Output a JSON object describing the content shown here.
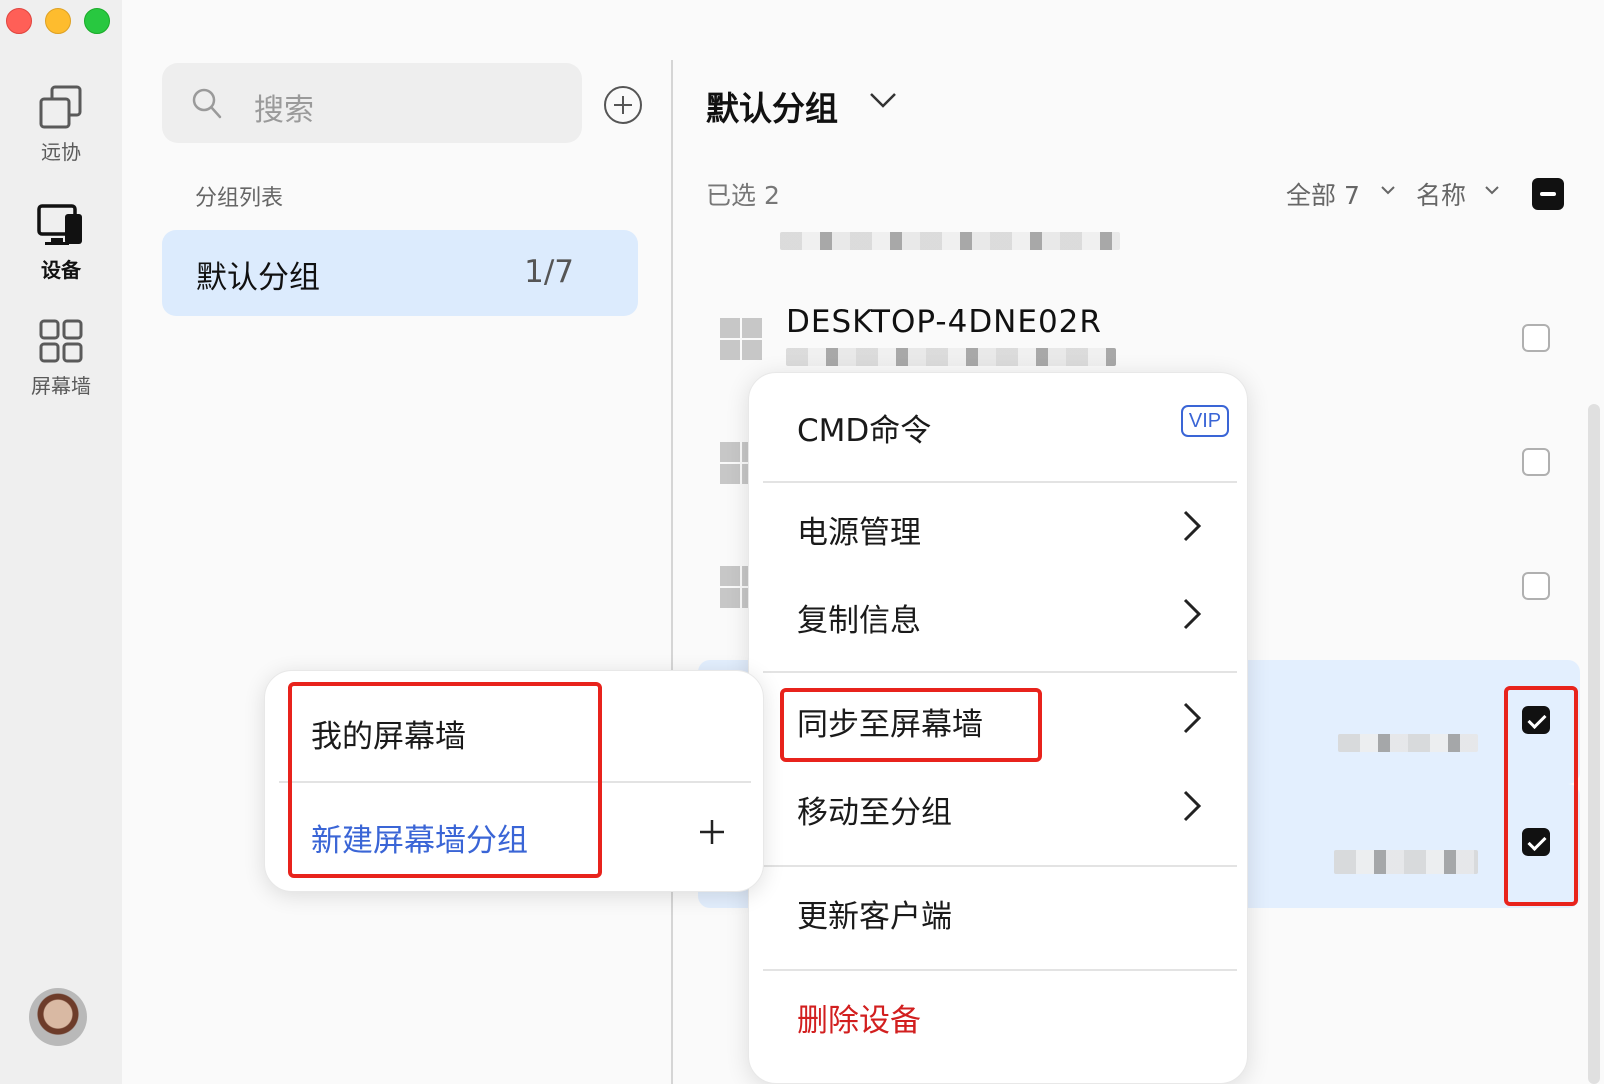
{
  "window": {
    "controls": {
      "close_color": "#ff5f57",
      "minimize_color": "#febc2e",
      "zoom_color": "#28c840"
    }
  },
  "rail": {
    "items": [
      {
        "label": "远协",
        "icon": "remote-assist-icon"
      },
      {
        "label": "设备",
        "icon": "device-icon",
        "active": true
      },
      {
        "label": "屏幕墙",
        "icon": "grid-icon"
      }
    ],
    "avatar": "avatar"
  },
  "groups": {
    "search_placeholder": "搜索",
    "list_title": "分组列表",
    "items": [
      {
        "name": "默认分组",
        "count": "1/7",
        "selected": true
      }
    ]
  },
  "devices": {
    "title": "默认分组",
    "selected_label": "已选 2",
    "filter_all": "全部 7",
    "sort_label": "名称",
    "rows": [
      {
        "name": "DESKTOP-4DNE02R",
        "checked": false
      }
    ]
  },
  "context_menu": {
    "items": [
      {
        "label": "CMD命令",
        "badge": "VIP"
      },
      {
        "label": "电源管理"
      },
      {
        "label": "复制信息"
      },
      {
        "label": "同步至屏幕墙"
      },
      {
        "label": "移动至分组"
      },
      {
        "label": "更新客户端"
      },
      {
        "label": "删除设备",
        "danger": true
      }
    ]
  },
  "submenu": {
    "items": [
      {
        "label": "我的屏幕墙"
      },
      {
        "label": "新建屏幕墙分组"
      }
    ]
  },
  "colors": {
    "accent": "#3a65d6",
    "danger": "#d21f1f",
    "highlight": "#e8231c",
    "selection": "#dcebfd"
  }
}
